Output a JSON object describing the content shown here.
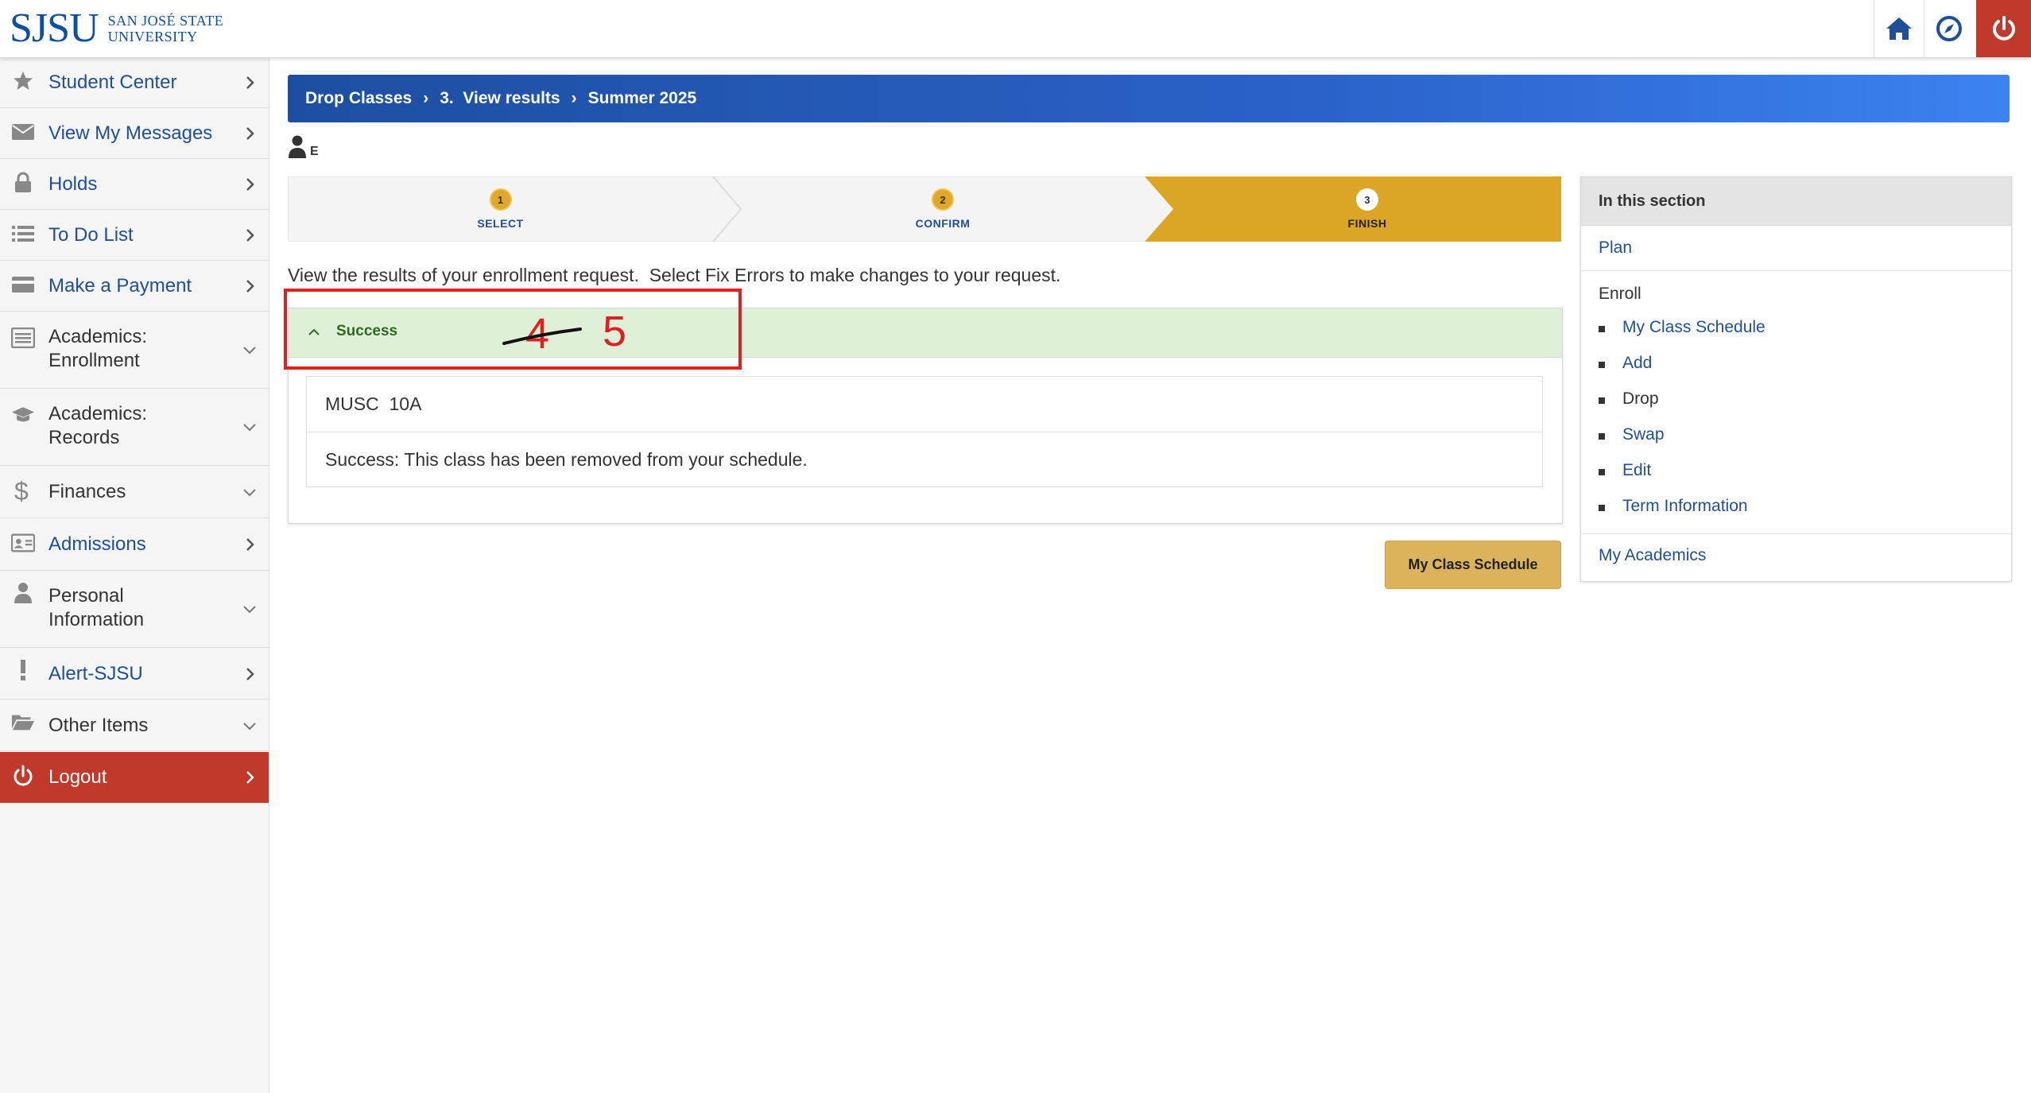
{
  "header": {
    "logo_mark": "SJSU",
    "logo_line1": "SAN JOSÉ STATE",
    "logo_line2": "UNIVERSITY",
    "icons": [
      "home-icon",
      "compass-icon",
      "power-icon"
    ]
  },
  "sidebar": {
    "items": [
      {
        "label": "Student Center",
        "icon": "star-icon",
        "chevron": "right"
      },
      {
        "label": "View My Messages",
        "icon": "envelope-icon",
        "chevron": "right"
      },
      {
        "label": "Holds",
        "icon": "lock-icon",
        "chevron": "right"
      },
      {
        "label": "To Do List",
        "icon": "list-icon",
        "chevron": "right"
      },
      {
        "label": "Make a Payment",
        "icon": "credit-card-icon",
        "chevron": "right"
      },
      {
        "label_line1": "Academics:",
        "label_line2": "Enrollment",
        "icon": "list-alt-icon",
        "chevron": "down"
      },
      {
        "label_line1": "Academics:",
        "label_line2": "Records",
        "icon": "graduation-cap-icon",
        "chevron": "down"
      },
      {
        "label": "Finances",
        "icon": "dollar-icon",
        "chevron": "down"
      },
      {
        "label": "Admissions",
        "icon": "id-card-icon",
        "chevron": "right"
      },
      {
        "label_line1": "Personal",
        "label_line2": "Information",
        "icon": "user-icon",
        "chevron": "down"
      },
      {
        "label": "Alert-SJSU",
        "icon": "exclamation-icon",
        "chevron": "right"
      },
      {
        "label": "Other Items",
        "icon": "folder-open-icon",
        "chevron": "down"
      },
      {
        "label": "Logout",
        "icon": "power-icon",
        "chevron": "right"
      }
    ]
  },
  "breadcrumb": {
    "items": [
      "Drop Classes",
      "3.  View results",
      "Summer 2025"
    ]
  },
  "user": {
    "initial": "E"
  },
  "steps": [
    {
      "num": "1",
      "label": "SELECT"
    },
    {
      "num": "2",
      "label": "CONFIRM"
    },
    {
      "num": "3",
      "label": "FINISH"
    }
  ],
  "instructions": "View the results of your enrollment request.  Select Fix Errors to make changes to your request.",
  "result": {
    "status": "Success",
    "course": "MUSC  10A",
    "message": "Success: This class has been removed from your schedule."
  },
  "annotation": {
    "struck": "4",
    "number": "5",
    "color": "#e02020"
  },
  "buttons": {
    "my_class_schedule": "My Class Schedule"
  },
  "section_nav": {
    "title": "In this section",
    "plan": "Plan",
    "enroll_heading": "Enroll",
    "enroll_items": [
      "My Class Schedule",
      "Add",
      "Drop",
      "Swap",
      "Edit",
      "Term Information"
    ],
    "my_academics": "My Academics"
  },
  "colors": {
    "brand_blue": "#0d4fa2",
    "link_blue": "#1f4e9b",
    "logout_red": "#c0392b",
    "step_active_gold": "#dba626",
    "success_bg": "#dff0d8",
    "button_gold": "#dbb35a"
  }
}
